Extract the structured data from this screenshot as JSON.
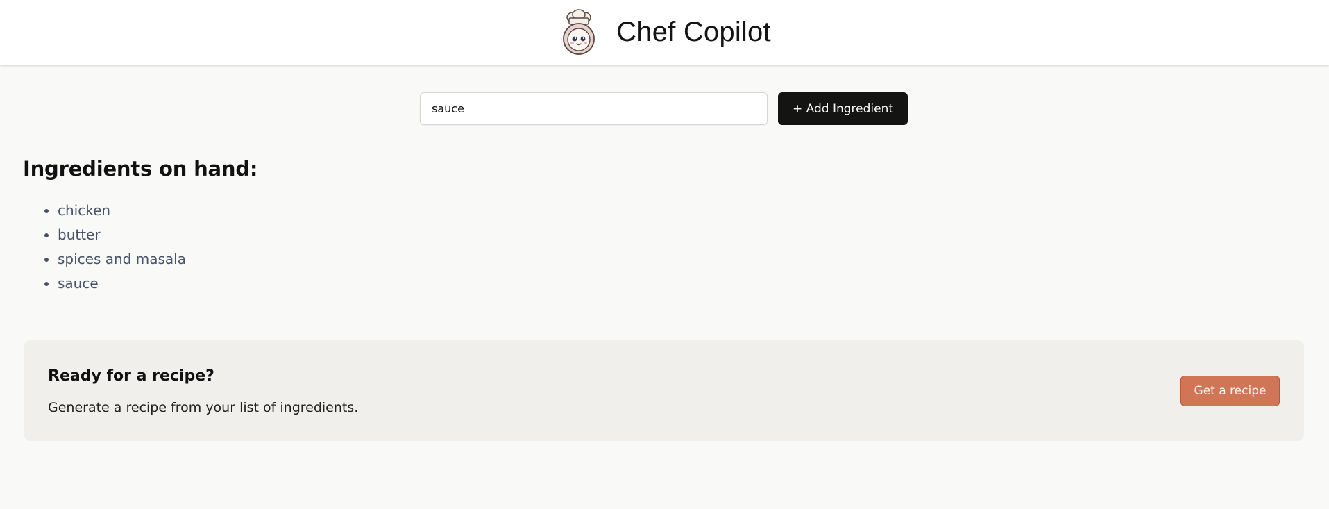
{
  "header": {
    "title": "Chef Copilot",
    "logo_icon": "chef-mascot-icon"
  },
  "form": {
    "input_value": "sauce",
    "add_button_label": "+ Add Ingredient"
  },
  "ingredients": {
    "heading": "Ingredients on hand:",
    "items": [
      "chicken",
      "butter",
      "spices and masala",
      "sauce"
    ]
  },
  "recipe_panel": {
    "heading": "Ready for a recipe?",
    "subtext": "Generate a recipe from your list of ingredients.",
    "button_label": "Get a recipe"
  },
  "colors": {
    "page_background": "#f9f9f7",
    "primary_button": "#141413",
    "accent_button": "#d17557",
    "panel_background": "#f0efeb",
    "list_text": "#46536a"
  }
}
